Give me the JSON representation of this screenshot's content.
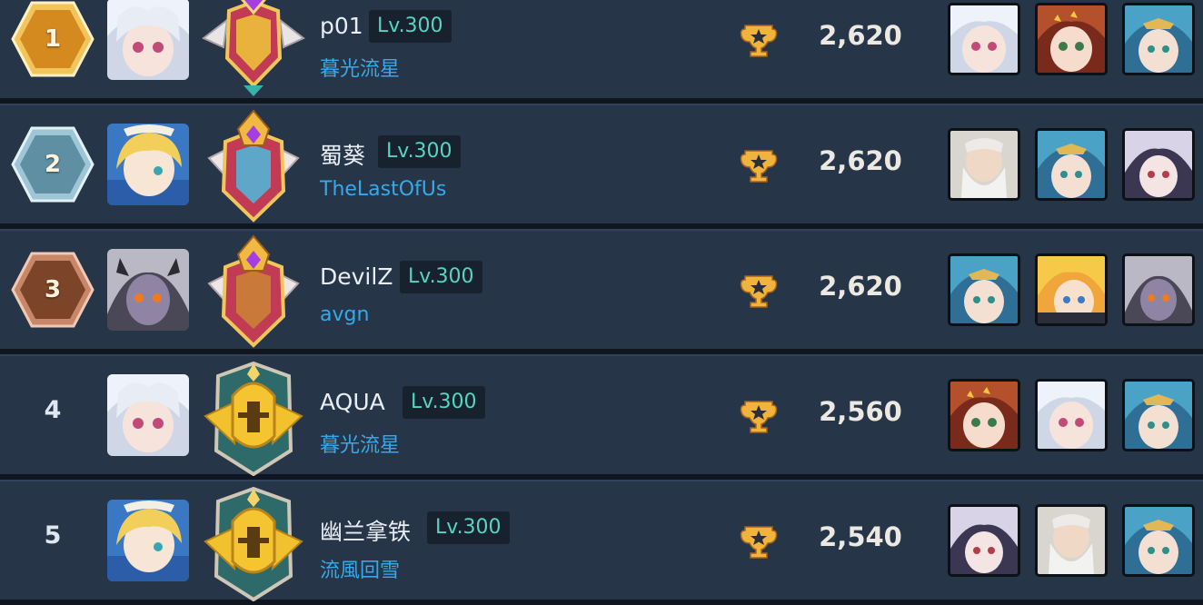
{
  "leaderboard": {
    "rows": [
      {
        "rank": "1",
        "avatar": "avatar-silver-haired",
        "emblem": "emblem-winged-purple-gem",
        "name": "p01",
        "level": "Lv.300",
        "guild": "暮光流星",
        "score": "2,620",
        "team": [
          "portrait-silver-haired",
          "portrait-red-haired",
          "portrait-teal-haired"
        ]
      },
      {
        "rank": "2",
        "avatar": "avatar-blonde-girl",
        "emblem": "emblem-crest-purple-gem",
        "name": "蜀葵",
        "level": "Lv.300",
        "guild": "TheLastOfUs",
        "score": "2,620",
        "team": [
          "portrait-white-bearded-elder",
          "portrait-teal-haired",
          "portrait-lilac-haired"
        ]
      },
      {
        "rank": "3",
        "avatar": "avatar-dark-horned",
        "emblem": "emblem-crest-purple-gem",
        "name": "DevilZ",
        "level": "Lv.300",
        "guild": "avgn",
        "score": "2,620",
        "team": [
          "portrait-teal-haired",
          "portrait-blonde-boy",
          "portrait-dark-horned"
        ]
      },
      {
        "rank": "4",
        "avatar": "avatar-silver-haired",
        "emblem": "emblem-golden-knight",
        "name": "AQUA",
        "level": "Lv.300",
        "guild": "暮光流星",
        "score": "2,560",
        "team": [
          "portrait-red-haired",
          "portrait-silver-haired",
          "portrait-teal-haired"
        ]
      },
      {
        "rank": "5",
        "avatar": "avatar-blonde-girl",
        "emblem": "emblem-golden-knight",
        "name": "幽兰拿铁",
        "level": "Lv.300",
        "guild": "流風回雪",
        "score": "2,540",
        "team": [
          "portrait-lilac-haired",
          "portrait-white-bearded-elder",
          "portrait-teal-haired"
        ]
      }
    ]
  },
  "colors": {
    "row_bg": "#273548",
    "level_text": "#56d6c1",
    "guild_text": "#36a9ec",
    "rank1_gold": "#d99a2b",
    "rank2_silver": "#7ea6b8",
    "rank3_bronze": "#8a5236"
  }
}
